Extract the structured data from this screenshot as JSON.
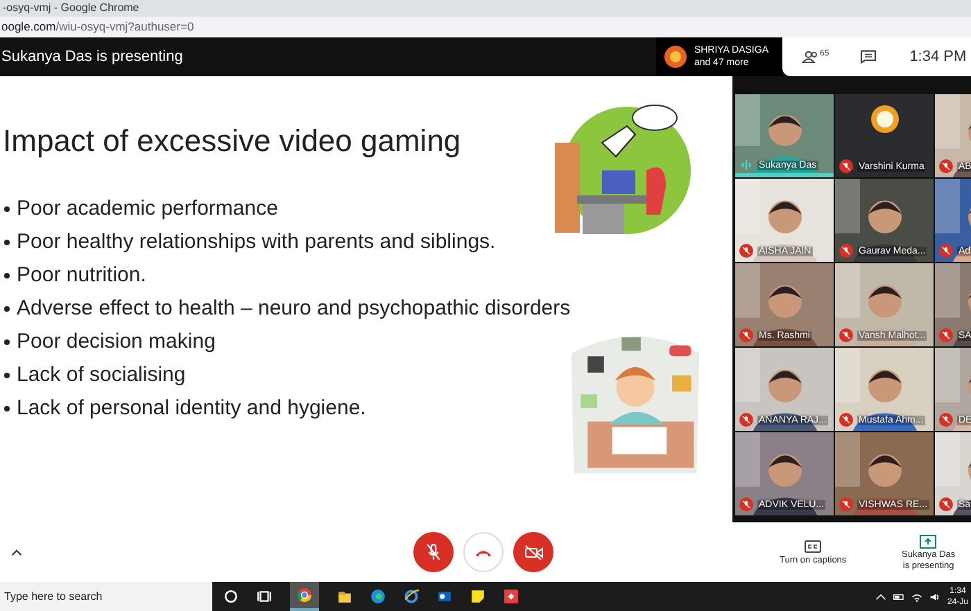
{
  "browser": {
    "title": "-osyq-vmj - Google Chrome",
    "url_host": "oogle.com",
    "url_path": "/wiu-osyq-vmj?authuser=0"
  },
  "meet_bar": {
    "presenting": "Sukanya Das is presenting",
    "joined_name": "SHRIYA DASIGA",
    "joined_more": "and 47 more",
    "people_count": "65",
    "time": "1:34 PM"
  },
  "slide": {
    "title": "Impact of excessive video gaming",
    "bullets": [
      "Poor academic performance",
      "Poor healthy relationships with parents and siblings.",
      "Poor nutrition.",
      "Adverse effect to health – neuro and psychopathic disorders",
      "Poor decision making",
      "Lack of socialising",
      "Lack of personal identity and hygiene."
    ]
  },
  "tiles": [
    {
      "name": "Sukanya Das",
      "muted": false,
      "highlighted": true,
      "kind": "video"
    },
    {
      "name": "Varshini Kurma",
      "muted": true,
      "highlighted": false,
      "kind": "avatar"
    },
    {
      "name": "AB",
      "muted": true,
      "highlighted": false,
      "kind": "video"
    },
    {
      "name": "AISHA JAIN",
      "muted": true,
      "highlighted": false,
      "kind": "video"
    },
    {
      "name": "Gaurav Meda...",
      "muted": true,
      "highlighted": false,
      "kind": "video"
    },
    {
      "name": "Ad",
      "muted": true,
      "highlighted": false,
      "kind": "video"
    },
    {
      "name": "Ms. Rashmi",
      "muted": true,
      "highlighted": false,
      "kind": "video"
    },
    {
      "name": "Vansh Malhot...",
      "muted": true,
      "highlighted": false,
      "kind": "video"
    },
    {
      "name": "SA",
      "muted": true,
      "highlighted": false,
      "kind": "video"
    },
    {
      "name": "ANANYA RAJ...",
      "muted": true,
      "highlighted": false,
      "kind": "video"
    },
    {
      "name": "Mustafa Ahm...",
      "muted": true,
      "highlighted": false,
      "kind": "video"
    },
    {
      "name": "DE",
      "muted": true,
      "highlighted": false,
      "kind": "video"
    },
    {
      "name": "ADVIK VELU...",
      "muted": true,
      "highlighted": false,
      "kind": "video"
    },
    {
      "name": "VISHWAS RE...",
      "muted": true,
      "highlighted": false,
      "kind": "video"
    },
    {
      "name": "Sa",
      "muted": true,
      "highlighted": false,
      "kind": "video"
    }
  ],
  "controls": {
    "mic_muted": true,
    "camera_off": true,
    "captions_label": "Turn on captions",
    "presenting_line1": "Sukanya Das",
    "presenting_line2": "is presenting"
  },
  "taskbar": {
    "search_placeholder": "Type here to search",
    "time": "1:34",
    "date": "24-Ju"
  }
}
